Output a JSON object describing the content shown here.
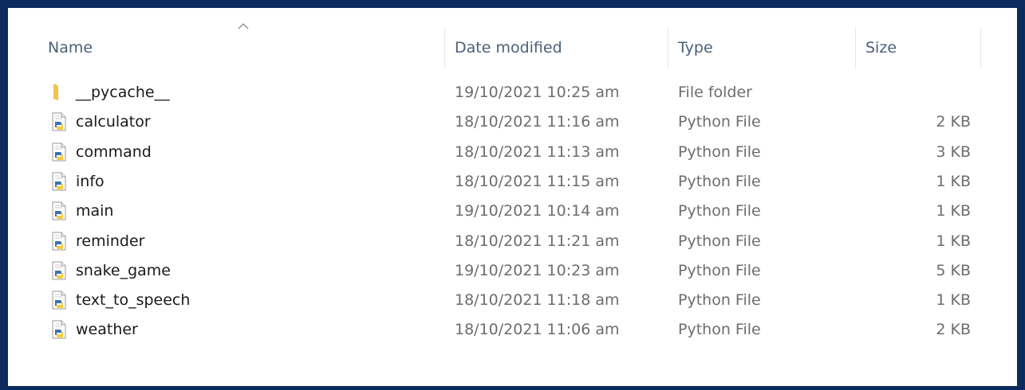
{
  "columns": {
    "name": "Name",
    "date": "Date modified",
    "type": "Type",
    "size": "Size"
  },
  "sort": {
    "column": "Name",
    "icon": "chevron-up-icon"
  },
  "files": [
    {
      "name": "__pycache__",
      "date": "19/10/2021 10:25 am",
      "type": "File folder",
      "size": "",
      "icon": "folder-icon"
    },
    {
      "name": "calculator",
      "date": "18/10/2021 11:16 am",
      "type": "Python File",
      "size": "2 KB",
      "icon": "python-file-icon"
    },
    {
      "name": "command",
      "date": "18/10/2021 11:13 am",
      "type": "Python File",
      "size": "3 KB",
      "icon": "python-file-icon"
    },
    {
      "name": "info",
      "date": "18/10/2021 11:15 am",
      "type": "Python File",
      "size": "1 KB",
      "icon": "python-file-icon"
    },
    {
      "name": "main",
      "date": "19/10/2021 10:14 am",
      "type": "Python File",
      "size": "1 KB",
      "icon": "python-file-icon"
    },
    {
      "name": "reminder",
      "date": "18/10/2021 11:21 am",
      "type": "Python File",
      "size": "1 KB",
      "icon": "python-file-icon"
    },
    {
      "name": "snake_game",
      "date": "19/10/2021 10:23 am",
      "type": "Python File",
      "size": "5 KB",
      "icon": "python-file-icon"
    },
    {
      "name": "text_to_speech",
      "date": "18/10/2021 11:18 am",
      "type": "Python File",
      "size": "1 KB",
      "icon": "python-file-icon"
    },
    {
      "name": "weather",
      "date": "18/10/2021 11:06 am",
      "type": "Python File",
      "size": "2 KB",
      "icon": "python-file-icon"
    }
  ],
  "colors": {
    "frame": "#0b2a5e",
    "header_text": "#4c607a",
    "folder": "#f3c24a",
    "python_blue": "#3a74b0",
    "python_yellow": "#f4cc3c"
  }
}
